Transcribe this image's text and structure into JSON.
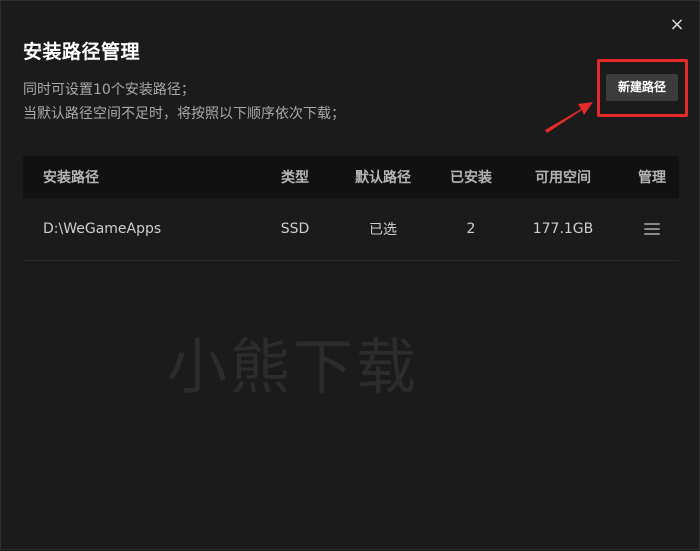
{
  "dialog": {
    "title": "安装路径管理",
    "close_glyph": "×",
    "desc_line1": "同时可设置10个安装路径；",
    "desc_line2": "当默认路径空间不足时，将按照以下顺序依次下载；",
    "new_path_label": "新建路径"
  },
  "table": {
    "headers": {
      "path": "安装路径",
      "type": "类型",
      "default": "默认路径",
      "installed": "已安装",
      "space": "可用空间",
      "manage": "管理"
    },
    "rows": [
      {
        "path": "D:\\WeGameApps",
        "type": "SSD",
        "default": "已选",
        "installed": "2",
        "space": "177.1GB",
        "manage_icon": "menu-icon"
      }
    ]
  },
  "watermark": "小熊下载",
  "colors": {
    "background": "#1b1b1b",
    "header_bg": "#111111",
    "annotation": "#e52a2a",
    "button_bg": "#3c3c3c"
  }
}
